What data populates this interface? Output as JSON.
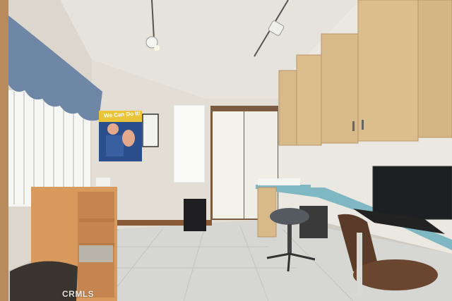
{
  "photo": {
    "alt": "Home office with vaulted ceiling, wall cabinets, desk with monitor, and closet",
    "poster_text": "We Can Do It!",
    "watermark": "CRMLS"
  },
  "colors": {
    "wall": "#e3ded5",
    "ceiling": "#e9e6e0",
    "cabinet": "#d8b98a",
    "desk_top": "#7fb8c2",
    "floor": "#d6d6d2",
    "curtain": "#6f87a6"
  }
}
